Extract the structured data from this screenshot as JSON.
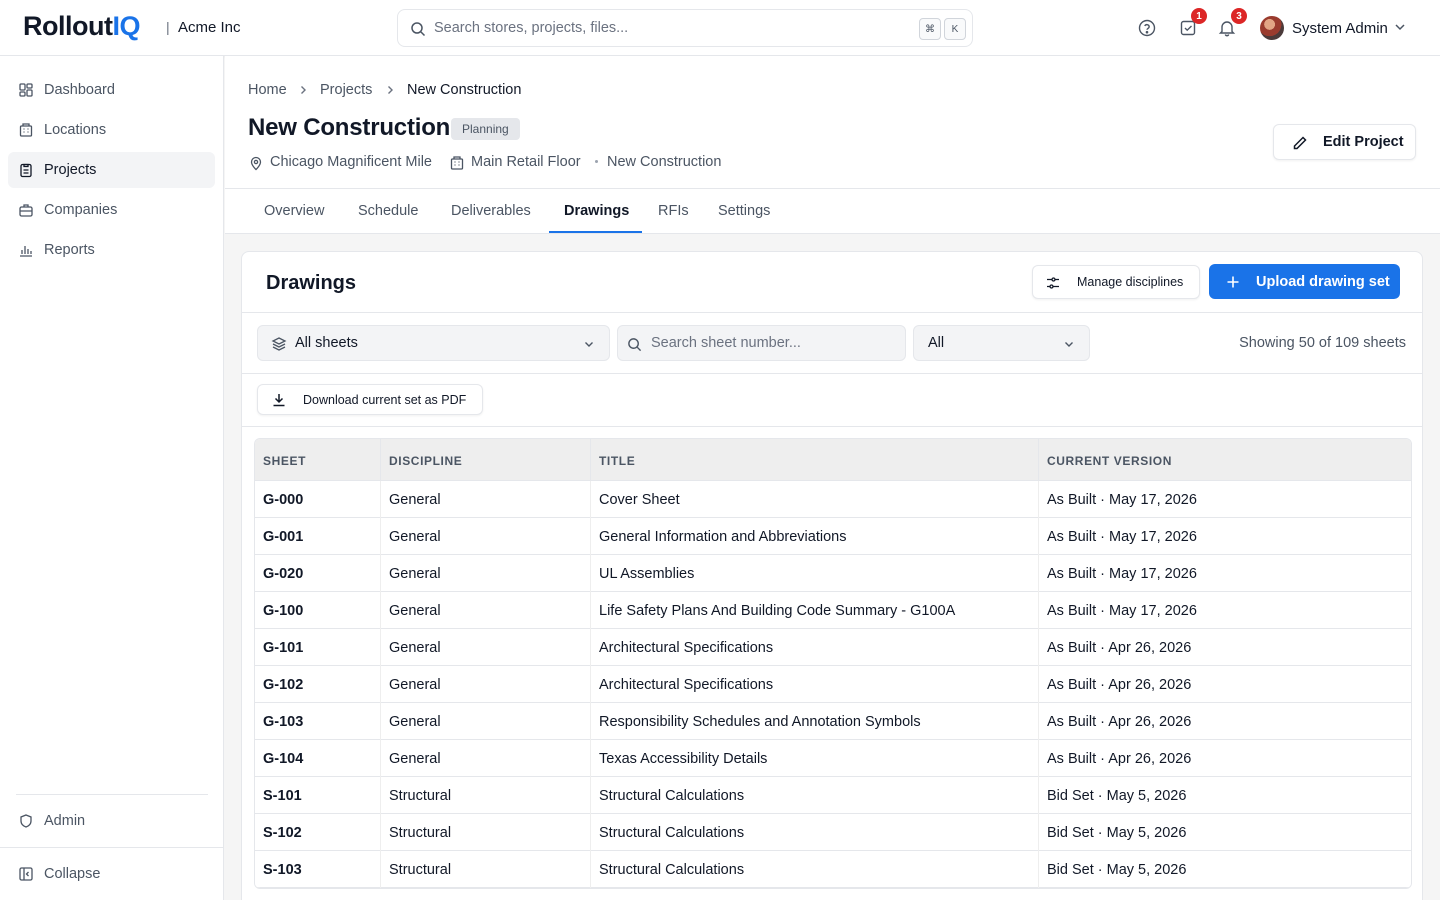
{
  "header": {
    "logo_main": "Rollout",
    "logo_accent": "IQ",
    "org_separator": "|",
    "org_name": "Acme Inc",
    "search_placeholder": "Search stores, projects, files...",
    "shortcut_key1": "⌘",
    "shortcut_key2": "K",
    "tasks_badge": "1",
    "notifications_badge": "3",
    "user_name": "System Admin"
  },
  "sidebar": {
    "items": [
      {
        "label": "Dashboard",
        "icon": "dashboard-icon"
      },
      {
        "label": "Locations",
        "icon": "building-icon"
      },
      {
        "label": "Projects",
        "icon": "clipboard-icon",
        "active": true
      },
      {
        "label": "Companies",
        "icon": "briefcase-icon"
      },
      {
        "label": "Reports",
        "icon": "bar-chart-icon"
      }
    ],
    "admin_label": "Admin",
    "collapse_label": "Collapse"
  },
  "breadcrumb": [
    "Home",
    "Projects",
    "New Construction"
  ],
  "project": {
    "title": "New Construction",
    "status": "Planning",
    "location": "Chicago Magnificent Mile",
    "space": "Main Retail Floor",
    "type": "New Construction",
    "edit_label": "Edit Project"
  },
  "tabs": [
    "Overview",
    "Schedule",
    "Deliverables",
    "Drawings",
    "RFIs",
    "Settings"
  ],
  "active_tab": "Drawings",
  "drawings": {
    "title": "Drawings",
    "manage_label": "Manage disciplines",
    "upload_label": "Upload drawing set",
    "sheet_filter": "All sheets",
    "search_placeholder": "Search sheet number...",
    "status_filter": "All",
    "showing": "Showing 50 of 109 sheets",
    "download_label": "Download current set as PDF",
    "columns": [
      "SHEET",
      "DISCIPLINE",
      "TITLE",
      "CURRENT VERSION"
    ],
    "rows": [
      [
        "G-000",
        "General",
        "Cover Sheet",
        "As Built · May 17, 2026"
      ],
      [
        "G-001",
        "General",
        "General Information and Abbreviations",
        "As Built · May 17, 2026"
      ],
      [
        "G-020",
        "General",
        "UL Assemblies",
        "As Built · May 17, 2026"
      ],
      [
        "G-100",
        "General",
        "Life Safety Plans And Building Code Summary - G100A",
        "As Built · May 17, 2026"
      ],
      [
        "G-101",
        "General",
        "Architectural Specifications",
        "As Built · Apr 26, 2026"
      ],
      [
        "G-102",
        "General",
        "Architectural Specifications",
        "As Built · Apr 26, 2026"
      ],
      [
        "G-103",
        "General",
        "Responsibility Schedules and Annotation Symbols",
        "As Built · Apr 26, 2026"
      ],
      [
        "G-104",
        "General",
        "Texas Accessibility Details",
        "As Built · Apr 26, 2026"
      ],
      [
        "S-101",
        "Structural",
        "Structural Calculations",
        "Bid Set · May 5, 2026"
      ],
      [
        "S-102",
        "Structural",
        "Structural Calculations",
        "Bid Set · May 5, 2026"
      ],
      [
        "S-103",
        "Structural",
        "Structural Calculations",
        "Bid Set · May 5, 2026"
      ]
    ]
  },
  "colors": {
    "accent": "#1a73e8",
    "badge": "#dc2626"
  }
}
